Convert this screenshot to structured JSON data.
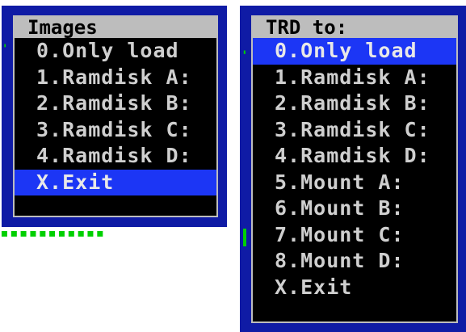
{
  "images_menu": {
    "title": "Images",
    "items": [
      {
        "label": "0.Only load",
        "selected": false
      },
      {
        "label": "1.Ramdisk A:",
        "selected": false
      },
      {
        "label": "2.Ramdisk B:",
        "selected": false
      },
      {
        "label": "3.Ramdisk C:",
        "selected": false
      },
      {
        "label": "4.Ramdisk D:",
        "selected": false
      },
      {
        "label": "X.Exit",
        "selected": true
      }
    ]
  },
  "trd_menu": {
    "title": "TRD to:",
    "items": [
      {
        "label": "0.Only load",
        "selected": true
      },
      {
        "label": "1.Ramdisk A:",
        "selected": false
      },
      {
        "label": "2.Ramdisk B:",
        "selected": false
      },
      {
        "label": "3.Ramdisk C:",
        "selected": false
      },
      {
        "label": "4.Ramdisk D:",
        "selected": false
      },
      {
        "label": "5.Mount A:",
        "selected": false
      },
      {
        "label": "6.Mount B:",
        "selected": false
      },
      {
        "label": "7.Mount C:",
        "selected": false
      },
      {
        "label": "8.Mount D:",
        "selected": false
      },
      {
        "label": "X.Exit",
        "selected": false
      }
    ]
  },
  "colors": {
    "frame_blue": "#0f1ba5",
    "highlight_blue": "#1c36f5",
    "title_gray": "#bdbdbd",
    "text_light": "#cfcfcf",
    "background_black": "#000000",
    "green_fragment": "#00d000"
  }
}
